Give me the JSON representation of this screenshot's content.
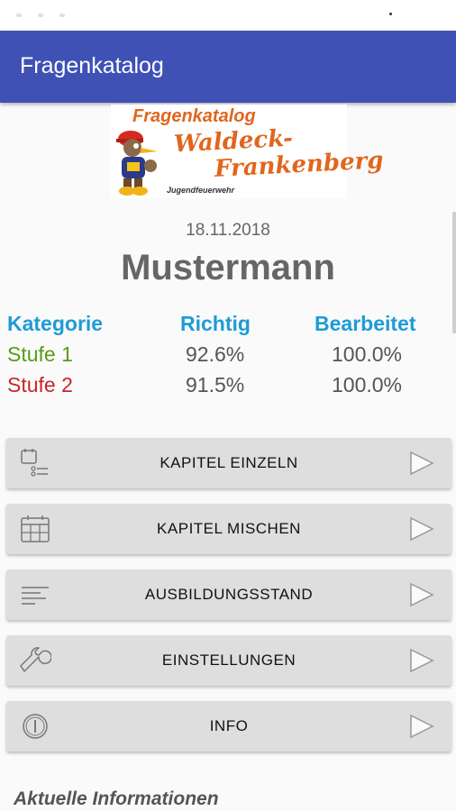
{
  "app": {
    "title": "Fragenkatalog"
  },
  "logo": {
    "line1": "Fragenkatalog",
    "line2": "Waldeck-",
    "line3": "Frankenberg",
    "line4": "Jugendfeuerwehr"
  },
  "profile": {
    "date": "18.11.2018",
    "name": "Mustermann"
  },
  "stats": {
    "headers": {
      "kategorie": "Kategorie",
      "richtig": "Richtig",
      "bearbeitet": "Bearbeitet"
    },
    "rows": [
      {
        "kategorie": "Stufe 1",
        "richtig": "92.6%",
        "bearbeitet": "100.0%",
        "color": "#5c9a1a"
      },
      {
        "kategorie": "Stufe 2",
        "richtig": "91.5%",
        "bearbeitet": "100.0%",
        "color": "#c62828"
      }
    ],
    "header_color": "#1e9bd7"
  },
  "menu": [
    {
      "label": "KAPITEL EINZELN",
      "icon": "checklist-icon"
    },
    {
      "label": "KAPITEL MISCHEN",
      "icon": "calendar-grid-icon"
    },
    {
      "label": "AUSBILDUNGSSTAND",
      "icon": "lines-icon"
    },
    {
      "label": "EINSTELLUNGEN",
      "icon": "wrench-icon"
    },
    {
      "label": "INFO",
      "icon": "info-icon"
    }
  ],
  "section": {
    "title": "Aktuelle Informationen"
  },
  "colors": {
    "primary": "#3f51b5",
    "accent_orange": "#e0661f"
  }
}
